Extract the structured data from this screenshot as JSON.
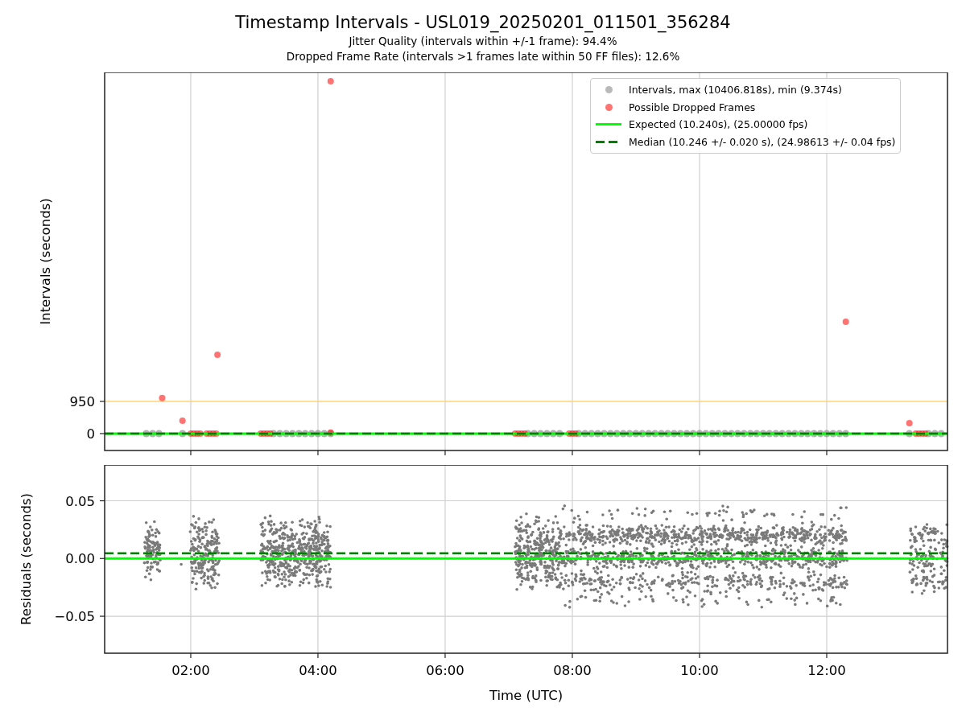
{
  "figure": {
    "title": "Timestamp Intervals - USL019_20250201_011501_356284",
    "subtitles": [
      "Jitter Quality (intervals within +/-1 frame): 94.4%",
      "Dropped Frame Rate (intervals >1 frames late within 50 FF files): 12.6%"
    ]
  },
  "intervals_chart": {
    "chart_data": {
      "type": "scatter",
      "ylabel": "Intervals (seconds)",
      "xlim": [
        0.646,
        13.899
      ],
      "ylim": [
        -499,
        10664
      ],
      "grid": true,
      "yticks": [
        {
          "value": 0,
          "label": "0"
        },
        {
          "value": 950,
          "label": "950"
        }
      ],
      "ref_lines": [
        {
          "axis": "y",
          "value": 950,
          "color": "#ffd27a"
        },
        {
          "axis": "y",
          "value": 0,
          "color": "#00ff00",
          "label": "Expected (10.240s), (25.00000 fps)"
        },
        {
          "axis": "y",
          "value": 0,
          "color": "#008000",
          "label": "Median (10.246 +/- 0.020 s), (24.98613 +/- 0.04 fps)"
        }
      ],
      "series": [
        {
          "name": "Intervals, max (10406.818s), min (9.374s)",
          "color": "#808080",
          "x": [
            1.3,
            1.4,
            1.5,
            1.87,
            3.3,
            3.4,
            3.5,
            3.6,
            3.7,
            3.8,
            3.9,
            4.0,
            4.1,
            4.2,
            7.3,
            7.4,
            7.5,
            7.6,
            7.7,
            7.8,
            8.1,
            8.2,
            8.3,
            8.4,
            8.5,
            8.6,
            8.7,
            8.8,
            8.9,
            9.0,
            9.1,
            9.2,
            9.3,
            9.4,
            9.5,
            9.6,
            9.7,
            9.8,
            9.9,
            10.0,
            10.1,
            10.2,
            10.3,
            10.4,
            10.5,
            10.6,
            10.7,
            10.8,
            10.9,
            11.0,
            11.1,
            11.2,
            11.3,
            11.4,
            11.5,
            11.6,
            11.7,
            11.8,
            11.9,
            12.0,
            12.1,
            12.2,
            12.3,
            13.3,
            13.6,
            13.7,
            13.8
          ],
          "values": [
            0,
            0,
            0,
            0,
            0,
            0,
            0,
            0,
            0,
            0,
            0,
            0,
            0,
            0,
            0,
            0,
            0,
            0,
            0,
            0,
            0,
            0,
            0,
            0,
            0,
            0,
            0,
            0,
            0,
            0,
            0,
            0,
            0,
            0,
            0,
            0,
            0,
            0,
            0,
            0,
            0,
            0,
            0,
            0,
            0,
            0,
            0,
            0,
            0,
            0,
            0,
            0,
            0,
            0,
            0,
            0,
            0,
            0,
            0,
            0,
            0,
            0,
            0,
            0,
            0,
            0,
            0
          ]
        },
        {
          "name": "Possible Dropped Frames",
          "color": "#ff0000",
          "x": [
            1.55,
            1.87,
            2.42,
            4.2,
            12.3,
            13.3,
            2.0,
            2.05,
            2.1,
            2.15,
            2.2,
            2.25,
            2.3,
            2.35,
            2.4,
            3.1,
            3.15,
            3.2,
            3.25,
            4.2,
            7.1,
            7.15,
            7.2,
            7.25,
            7.9,
            7.95,
            8.0,
            8.05,
            13.4,
            13.45,
            13.5,
            13.55
          ],
          "values": [
            1050,
            380,
            2330,
            10400,
            3300,
            310,
            0,
            0,
            0,
            0,
            null,
            0,
            0,
            0,
            0,
            0,
            0,
            0,
            0,
            30,
            0,
            0,
            0,
            0,
            null,
            0,
            0,
            0,
            0,
            0,
            0,
            0
          ]
        }
      ]
    }
  },
  "residuals_chart": {
    "chart_data": {
      "type": "scatter",
      "xlabel": "Time (UTC)",
      "ylabel": "Residuals (seconds)",
      "xlim": [
        0.646,
        13.899
      ],
      "ylim": [
        -0.082,
        0.081
      ],
      "grid": true,
      "xticks": [
        {
          "value": 2,
          "label": "02:00"
        },
        {
          "value": 4,
          "label": "04:00"
        },
        {
          "value": 6,
          "label": "06:00"
        },
        {
          "value": 8,
          "label": "08:00"
        },
        {
          "value": 10,
          "label": "10:00"
        },
        {
          "value": 12,
          "label": "12:00"
        }
      ],
      "yticks": [
        {
          "value": 0.05,
          "label": "0.05"
        },
        {
          "value": 0,
          "label": "0.00"
        },
        {
          "value": -0.05,
          "label": "−0.05"
        }
      ],
      "ref_lines": [
        {
          "axis": "y",
          "value": 0,
          "color": "#00ff00"
        },
        {
          "axis": "y",
          "value": 0.0045,
          "color": "#008000"
        }
      ]
    }
  }
}
